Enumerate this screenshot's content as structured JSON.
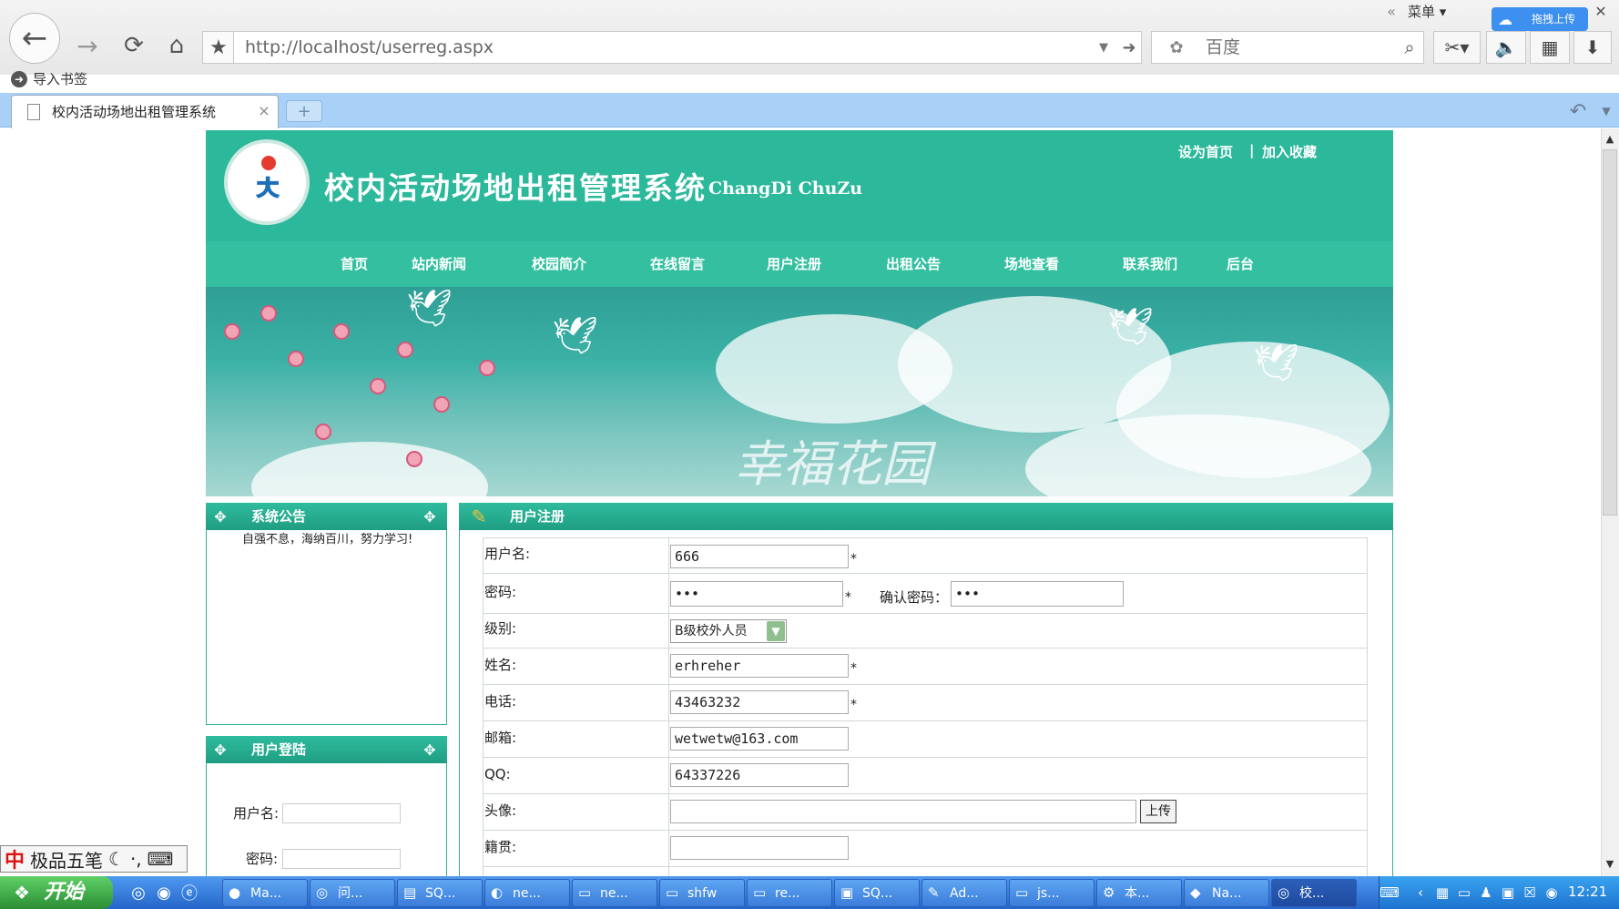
{
  "browser": {
    "url": "http://localhost/userreg.aspx",
    "search_placeholder": "百度",
    "menu_label": "菜单",
    "upload_label": "拖拽上传",
    "bookmark_import": "导入书签",
    "tab_title": "校内活动场地出租管理系统"
  },
  "site": {
    "title": "校内活动场地出租管理系统",
    "title_en": "ChangDi ChuZu",
    "set_home": "设为首页",
    "separator": "|",
    "add_favorite": "加入收藏",
    "nav": [
      "首页",
      "站内新闻",
      "校园简介",
      "在线留言",
      "用户注册",
      "出租公告",
      "场地查看",
      "联系我们",
      "后台"
    ],
    "banner_text": "幸福花园"
  },
  "notice": {
    "title": "系统公告",
    "text": "自强不息，海纳百川，努力学习!"
  },
  "login": {
    "title": "用户登陆",
    "username_label": "用户名:",
    "password_label": "密码:"
  },
  "register": {
    "title": "用户注册",
    "fields": {
      "username": {
        "label": "用户名:",
        "value": "666"
      },
      "password": {
        "label": "密码:",
        "value": "•••"
      },
      "confirm": {
        "label": "确认密码：",
        "value": "•••"
      },
      "level": {
        "label": "级别:",
        "value": "B级校外人员"
      },
      "name": {
        "label": "姓名:",
        "value": "erhreher"
      },
      "phone": {
        "label": "电话:",
        "value": "43463232"
      },
      "email": {
        "label": "邮箱:",
        "value": "wetwetw@163.com"
      },
      "qq": {
        "label": "QQ:",
        "value": "64337226"
      },
      "avatar": {
        "label": "头像:",
        "value": ""
      },
      "native": {
        "label": "籍贯:",
        "value": ""
      }
    },
    "upload_button": "上传",
    "required_mark": "*"
  },
  "ime": {
    "name": "极品五笔",
    "icon": "中"
  },
  "taskbar": {
    "start": "开始",
    "tasks": [
      "Ma...",
      "问...",
      "SQ...",
      "ne...",
      "ne...",
      "shfw",
      "re...",
      "SQ...",
      "Ad...",
      "js...",
      "本...",
      "Na...",
      "校..."
    ],
    "clock": "12:21"
  }
}
